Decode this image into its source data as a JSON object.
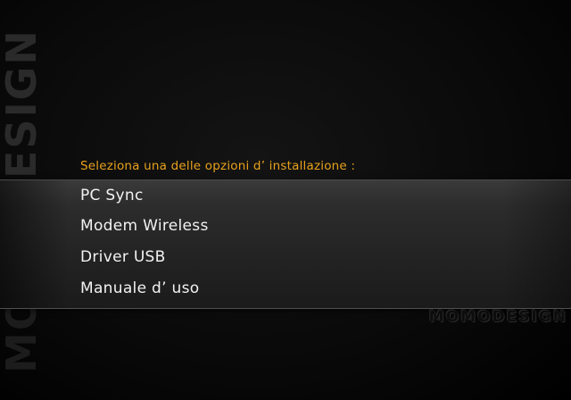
{
  "brand": {
    "side_logo_left": "MOMO",
    "side_logo_right": "DESIGN",
    "corner_logo": "MOMODESIGN"
  },
  "prompt": "Seleziona una delle opzioni d’ installazione :",
  "menu": {
    "items": [
      {
        "label": "PC Sync"
      },
      {
        "label": "Modem Wireless"
      },
      {
        "label": "Driver USB"
      },
      {
        "label": "Manuale d’ uso"
      }
    ]
  },
  "colors": {
    "accent": "#e8a11c",
    "item_text": "#f2f2f2",
    "background": "#000000"
  }
}
